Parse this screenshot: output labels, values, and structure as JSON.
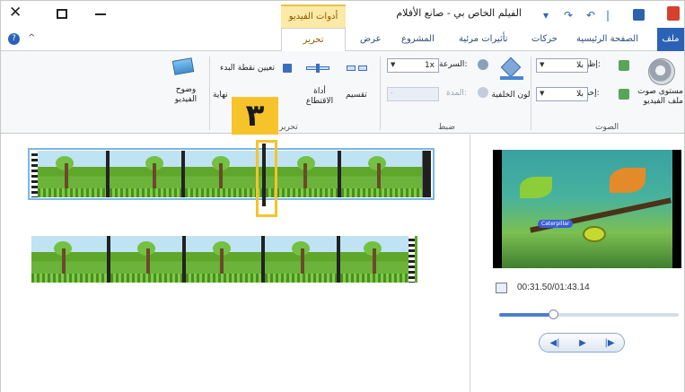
{
  "window": {
    "title": "الفيلم الخاص بي - صانع الأفلام",
    "context_tab": "أدوات الفيديو"
  },
  "window_controls": {
    "close": "✕"
  },
  "tabs": [
    {
      "label": "ملف"
    },
    {
      "label": "الصفحة الرئيسية"
    },
    {
      "label": "حركات"
    },
    {
      "label": "تأثيرات مرئية"
    },
    {
      "label": "المشروع"
    },
    {
      "label": "عرض"
    },
    {
      "label": "تحرير"
    }
  ],
  "ribbon": {
    "audio": {
      "group_label": "الصوت",
      "video_volume_label": "مستوى صوت ملف الفيديو",
      "fade_in_label": "إظهار:",
      "fade_in_value": "بلا",
      "fade_out_label": "إخفاء:",
      "fade_out_value": "بلا"
    },
    "adjust": {
      "group_label": "ضبط",
      "bg_color_label": "لون الخلفية",
      "speed_label": "السرعة:",
      "speed_value": "1x",
      "duration_label": "المدة:",
      "duration_value": ""
    },
    "edit": {
      "group_label": "تحرير",
      "split_label": "تقسيم",
      "trim_label": "أداة الاقتطاع",
      "set_start_label": "تعيين نقطة البدء",
      "set_end_label": "نهاية",
      "stabilize_label": "وضوح الفيديو"
    }
  },
  "marker": {
    "text": "٣"
  },
  "preview": {
    "time": "00:31.50/01:43.14",
    "progress": 0.3,
    "caption_tag": "Caterpillar"
  },
  "playback": {
    "prev": "◀|",
    "play": "▶",
    "next": "|▶"
  },
  "colors": {
    "accent": "#2b62b5",
    "context_tab": "#fbe9a6",
    "marker": "#f6c32b"
  }
}
